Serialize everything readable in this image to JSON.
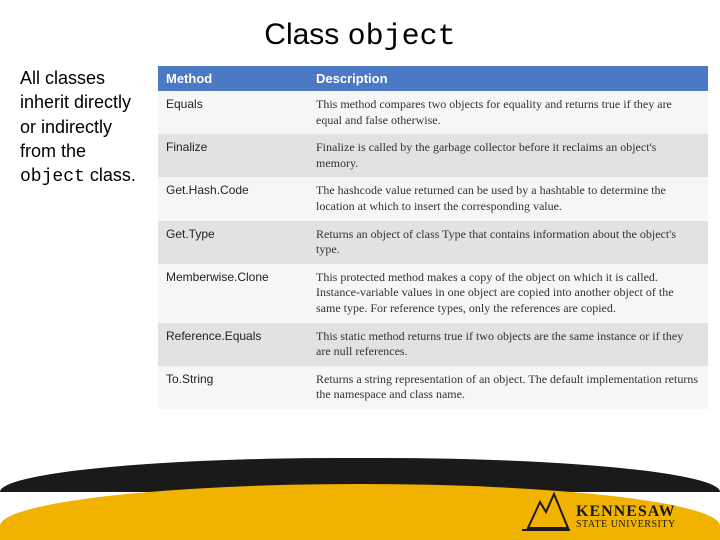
{
  "title_prefix": "Class ",
  "title_mono": "object",
  "sidebar_pre": "All classes inherit directly or indirectly from the ",
  "sidebar_mono": "object",
  "sidebar_post": " class.",
  "headers": {
    "method": "Method",
    "desc": "Description"
  },
  "rows": [
    {
      "method": "Equals",
      "desc": "This method compares two objects for equality and returns true if they are equal and false otherwise."
    },
    {
      "method": "Finalize",
      "desc": "Finalize is called by the garbage collector before it reclaims an object's memory."
    },
    {
      "method": "Get.Hash.Code",
      "desc": "The hashcode value returned can be used by a hashtable to determine the location at which to insert the corresponding value."
    },
    {
      "method": "Get.Type",
      "desc": "Returns an object of class Type that contains information about the object's type."
    },
    {
      "method": "Memberwise.Clone",
      "desc": "This protected method makes a copy of the object on which it is called. Instance-variable values in one object are copied into another object of the same type. For reference types, only the references are copied."
    },
    {
      "method": "Reference.Equals",
      "desc": "This static method returns true if two objects are the same instance or if they are null references."
    },
    {
      "method": "To.String",
      "desc": "Returns a string representation of an object. The default implementation returns the namespace and class name."
    }
  ],
  "logo": {
    "line1": "KENNESAW",
    "line2": "STATE UNIVERSITY"
  }
}
